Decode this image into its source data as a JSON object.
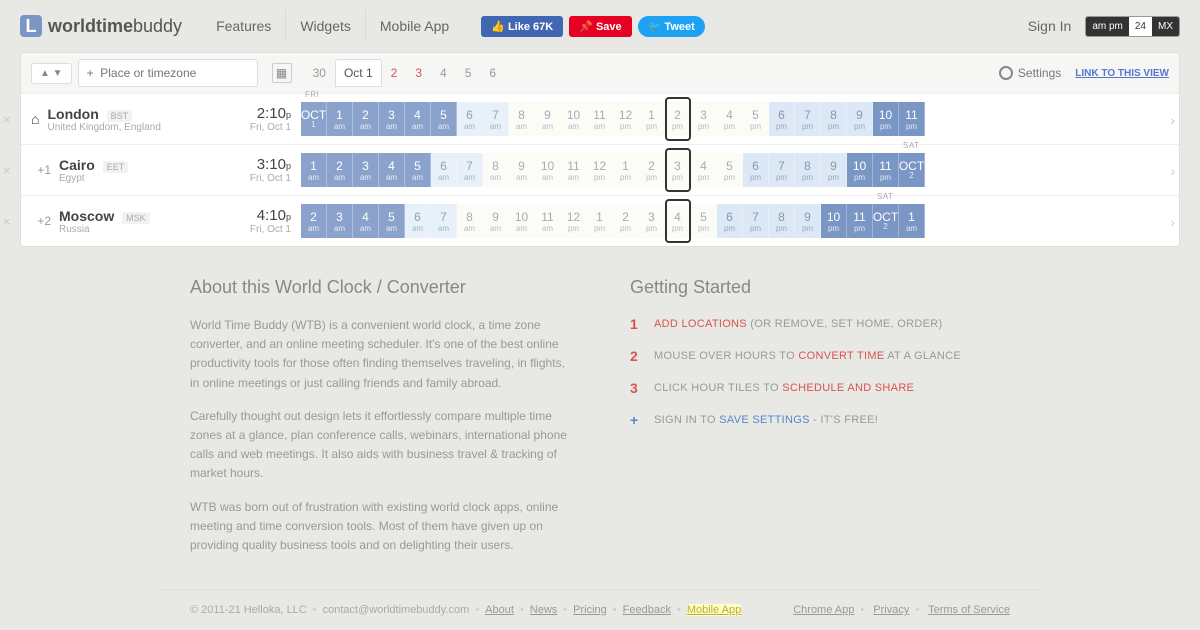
{
  "header": {
    "logo_bold": "worldtime",
    "logo_light": "buddy",
    "nav": [
      "Features",
      "Widgets",
      "Mobile App"
    ],
    "social": {
      "fb": "Like 67K",
      "pin": "Save",
      "tw": "Tweet"
    },
    "signin": "Sign In",
    "fmt": [
      "am pm",
      "24",
      "MX"
    ]
  },
  "toolbar": {
    "sort": "▲ ▼",
    "placeholder": "+  Place or timezone",
    "dates": [
      "30",
      "Oct 1",
      "2",
      "3",
      "4",
      "5",
      "6"
    ],
    "settings": "Settings",
    "link": "LINK TO THIS VIEW"
  },
  "rows": [
    {
      "offset": "",
      "home": true,
      "city": "London",
      "tz": "BST",
      "country": "United Kingdom, England",
      "time": "2:10",
      "ampm": "p",
      "date": "Fri, Oct 1",
      "daylabel": "FRI",
      "daylabel_pos": 0,
      "hours": [
        {
          "t": "OCT",
          "s": "1",
          "c": "night datecell"
        },
        {
          "t": "1",
          "s": "am",
          "c": "night"
        },
        {
          "t": "2",
          "s": "am",
          "c": "night"
        },
        {
          "t": "3",
          "s": "am",
          "c": "night"
        },
        {
          "t": "4",
          "s": "am",
          "c": "night"
        },
        {
          "t": "5",
          "s": "am",
          "c": "night"
        },
        {
          "t": "6",
          "s": "am",
          "c": "morning"
        },
        {
          "t": "7",
          "s": "am",
          "c": "morning"
        },
        {
          "t": "8",
          "s": "am",
          "c": "day"
        },
        {
          "t": "9",
          "s": "am",
          "c": "day"
        },
        {
          "t": "10",
          "s": "am",
          "c": "day"
        },
        {
          "t": "11",
          "s": "am",
          "c": "day"
        },
        {
          "t": "12",
          "s": "pm",
          "c": "day"
        },
        {
          "t": "1",
          "s": "pm",
          "c": "day"
        },
        {
          "t": "2",
          "s": "pm",
          "c": "day"
        },
        {
          "t": "3",
          "s": "pm",
          "c": "day"
        },
        {
          "t": "4",
          "s": "pm",
          "c": "day"
        },
        {
          "t": "5",
          "s": "pm",
          "c": "day"
        },
        {
          "t": "6",
          "s": "pm",
          "c": "evening"
        },
        {
          "t": "7",
          "s": "pm",
          "c": "evening"
        },
        {
          "t": "8",
          "s": "pm",
          "c": "evening"
        },
        {
          "t": "9",
          "s": "pm",
          "c": "evening"
        },
        {
          "t": "10",
          "s": "pm",
          "c": "night2"
        },
        {
          "t": "11",
          "s": "pm",
          "c": "night2"
        }
      ],
      "sel": 14
    },
    {
      "offset": "+1",
      "home": false,
      "city": "Cairo",
      "tz": "EET",
      "country": "Egypt",
      "time": "3:10",
      "ampm": "p",
      "date": "Fri, Oct 1",
      "daylabel": "SAT",
      "daylabel_pos": 23,
      "hours": [
        {
          "t": "1",
          "s": "am",
          "c": "night"
        },
        {
          "t": "2",
          "s": "am",
          "c": "night"
        },
        {
          "t": "3",
          "s": "am",
          "c": "night"
        },
        {
          "t": "4",
          "s": "am",
          "c": "night"
        },
        {
          "t": "5",
          "s": "am",
          "c": "night"
        },
        {
          "t": "6",
          "s": "am",
          "c": "morning"
        },
        {
          "t": "7",
          "s": "am",
          "c": "morning"
        },
        {
          "t": "8",
          "s": "am",
          "c": "day"
        },
        {
          "t": "9",
          "s": "am",
          "c": "day"
        },
        {
          "t": "10",
          "s": "am",
          "c": "day"
        },
        {
          "t": "11",
          "s": "am",
          "c": "day"
        },
        {
          "t": "12",
          "s": "pm",
          "c": "day"
        },
        {
          "t": "1",
          "s": "pm",
          "c": "day"
        },
        {
          "t": "2",
          "s": "pm",
          "c": "day"
        },
        {
          "t": "3",
          "s": "pm",
          "c": "day"
        },
        {
          "t": "4",
          "s": "pm",
          "c": "day"
        },
        {
          "t": "5",
          "s": "pm",
          "c": "day"
        },
        {
          "t": "6",
          "s": "pm",
          "c": "evening"
        },
        {
          "t": "7",
          "s": "pm",
          "c": "evening"
        },
        {
          "t": "8",
          "s": "pm",
          "c": "evening"
        },
        {
          "t": "9",
          "s": "pm",
          "c": "evening"
        },
        {
          "t": "10",
          "s": "pm",
          "c": "night2"
        },
        {
          "t": "11",
          "s": "pm",
          "c": "night2"
        },
        {
          "t": "OCT",
          "s": "2",
          "c": "night2 datecell"
        }
      ],
      "sel": 14
    },
    {
      "offset": "+2",
      "home": false,
      "city": "Moscow",
      "tz": "MSK",
      "country": "Russia",
      "time": "4:10",
      "ampm": "p",
      "date": "Fri, Oct 1",
      "daylabel": "SAT",
      "daylabel_pos": 22,
      "hours": [
        {
          "t": "2",
          "s": "am",
          "c": "night"
        },
        {
          "t": "3",
          "s": "am",
          "c": "night"
        },
        {
          "t": "4",
          "s": "am",
          "c": "night"
        },
        {
          "t": "5",
          "s": "am",
          "c": "night"
        },
        {
          "t": "6",
          "s": "am",
          "c": "morning"
        },
        {
          "t": "7",
          "s": "am",
          "c": "morning"
        },
        {
          "t": "8",
          "s": "am",
          "c": "day"
        },
        {
          "t": "9",
          "s": "am",
          "c": "day"
        },
        {
          "t": "10",
          "s": "am",
          "c": "day"
        },
        {
          "t": "11",
          "s": "am",
          "c": "day"
        },
        {
          "t": "12",
          "s": "pm",
          "c": "day"
        },
        {
          "t": "1",
          "s": "pm",
          "c": "day"
        },
        {
          "t": "2",
          "s": "pm",
          "c": "day"
        },
        {
          "t": "3",
          "s": "pm",
          "c": "day"
        },
        {
          "t": "4",
          "s": "pm",
          "c": "day"
        },
        {
          "t": "5",
          "s": "pm",
          "c": "day"
        },
        {
          "t": "6",
          "s": "pm",
          "c": "evening"
        },
        {
          "t": "7",
          "s": "pm",
          "c": "evening"
        },
        {
          "t": "8",
          "s": "pm",
          "c": "evening"
        },
        {
          "t": "9",
          "s": "pm",
          "c": "evening"
        },
        {
          "t": "10",
          "s": "pm",
          "c": "night2"
        },
        {
          "t": "11",
          "s": "pm",
          "c": "night2"
        },
        {
          "t": "OCT",
          "s": "2",
          "c": "night2 datecell"
        },
        {
          "t": "1",
          "s": "am",
          "c": "night2"
        }
      ],
      "sel": 14
    }
  ],
  "about": {
    "title": "About this World Clock / Converter",
    "p1": "World Time Buddy (WTB) is a convenient world clock, a time zone converter, and an online meeting scheduler. It's one of the best online productivity tools for those often finding themselves traveling, in flights, in online meetings or just calling friends and family abroad.",
    "p2": "Carefully thought out design lets it effortlessly compare multiple time zones at a glance, plan conference calls, webinars, international phone calls and web meetings. It also aids with business travel & tracking of market hours.",
    "p3": "WTB was born out of frustration with existing world clock apps, online meeting and time conversion tools. Most of them have given up on providing quality business tools and on delighting their users."
  },
  "getting": {
    "title": "Getting Started",
    "s1a": "ADD LOCATIONS ",
    "s1b": "(OR REMOVE, SET HOME, ORDER)",
    "s2a": "MOUSE OVER HOURS TO ",
    "s2b": "CONVERT TIME",
    "s2c": " AT A GLANCE",
    "s3a": "CLICK HOUR TILES TO ",
    "s3b": "SCHEDULE AND SHARE",
    "s4a": "SIGN IN TO ",
    "s4b": "SAVE SETTINGS",
    "s4c": " - IT'S FREE!"
  },
  "footer": {
    "copy": "© 2011-21 Helloka, LLC",
    "contact": "contact@worldtimebuddy.com",
    "links": [
      "About",
      "News",
      "Pricing",
      "Feedback",
      "Mobile App"
    ],
    "right": [
      "Chrome App",
      "Privacy",
      "Terms of Service"
    ]
  }
}
